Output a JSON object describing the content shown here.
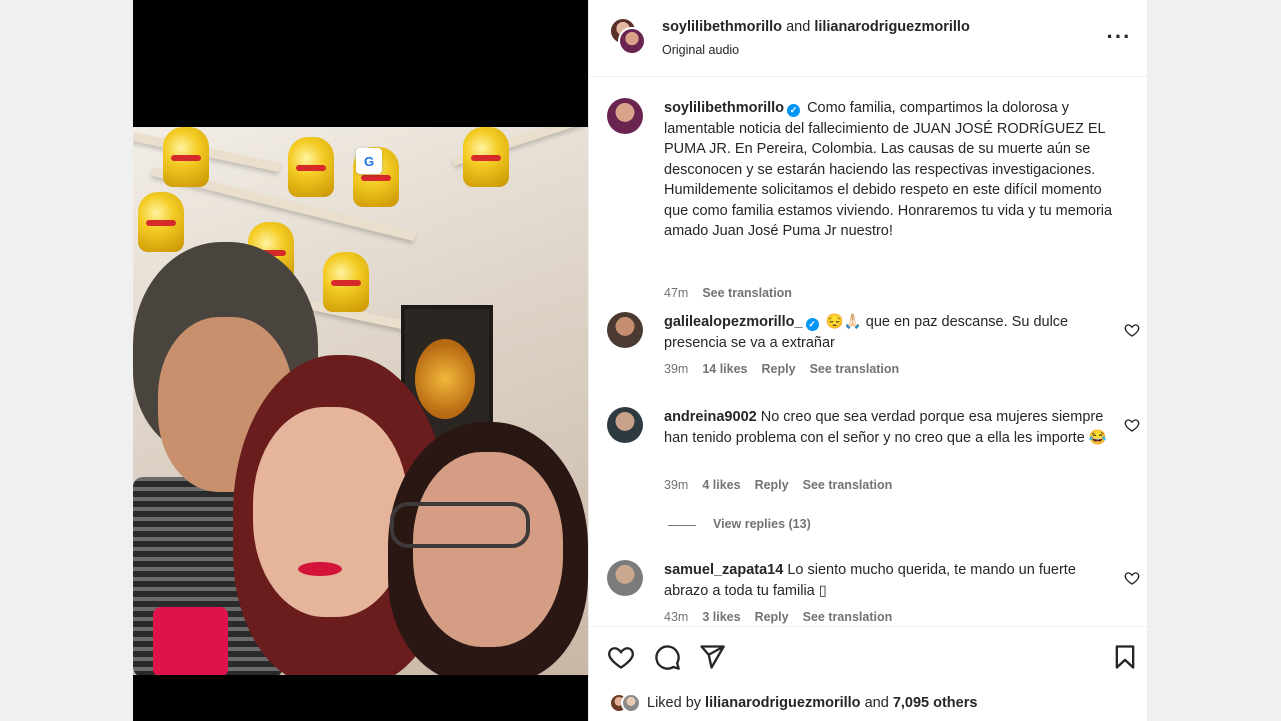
{
  "post": {
    "header": {
      "user1": "soylilibethmorillo",
      "joiner": "and",
      "user2": "lilianarodriguezmorillo",
      "audio": "Original audio"
    },
    "caption": {
      "user": "soylilibethmorillo",
      "text": "Como familia, compartimos la dolorosa y lamentable noticia del fallecimiento de JUAN JOSÉ RODRÍGUEZ EL PUMA JR. En Pereira, Colombia. Las causas de su muerte aún se desconocen y se estarán haciendo las respectivas investigaciones. Humildemente solicitamos el debido respeto en este difícil momento que como familia estamos viviendo. Honraremos tu vida y tu memoria amado Juan José Puma Jr nuestro!",
      "time": "47m",
      "see_translation": "See translation"
    },
    "comments": [
      {
        "user": "galilealopezmorillo_",
        "verified": true,
        "text": "😔🙏🏻 que en paz descanse. Su dulce presencia se va a extrañar",
        "time": "39m",
        "likes": "14 likes",
        "reply": "Reply",
        "see_translation": "See translation"
      },
      {
        "user": "andreina9002",
        "verified": false,
        "text": "No creo que sea verdad porque esa mujeres siempre han tenido problema con el señor y no creo que a ella les importe 😂",
        "time": "39m",
        "likes": "4 likes",
        "reply": "Reply",
        "see_translation": "See translation",
        "view_replies": "View replies (13)"
      },
      {
        "user": "samuel_zapata14",
        "verified": false,
        "text": "Lo siento mucho querida, te mando un fuerte abrazo a toda tu familia ▯",
        "time": "43m",
        "likes": "3 likes",
        "reply": "Reply",
        "see_translation": "See translation"
      }
    ],
    "liked_by": {
      "prefix": "Liked by",
      "user": "lilianarodriguezmorillo",
      "joiner": "and",
      "others": "7,095 others"
    }
  },
  "icons": {
    "verified": "verified-badge-icon",
    "translate": "google-translate-icon",
    "more": "more-options-icon",
    "like": "heart-icon",
    "comment": "comment-icon",
    "share": "share-icon",
    "save": "bookmark-icon"
  },
  "colors": {
    "accent": "#0095f6",
    "muted": "#737373",
    "text": "#262626"
  }
}
